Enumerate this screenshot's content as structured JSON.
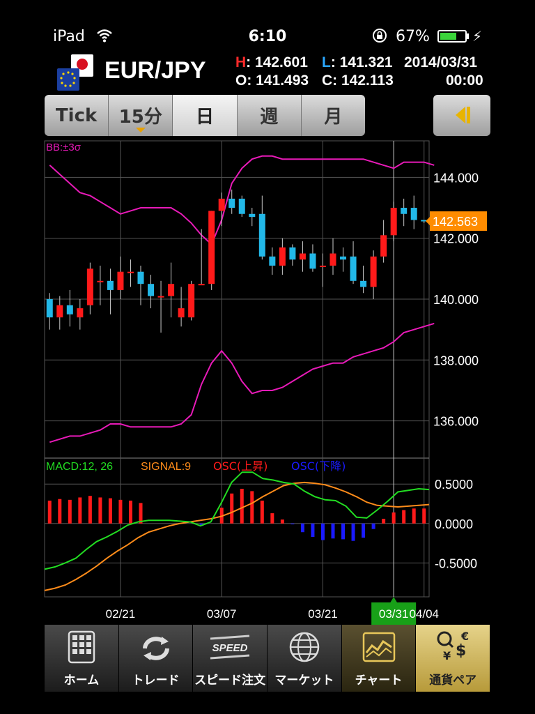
{
  "status": {
    "carrier": "iPad",
    "time": "6:10",
    "battery": "67%",
    "battery_level": 0.67
  },
  "header": {
    "pair": "EUR/JPY",
    "h_key": "H",
    "h": ": 142.601",
    "l_key": "L",
    "l": ": 141.321",
    "o": "O: 141.493",
    "c": "C: 142.113",
    "date": "2014/03/31",
    "time": "00:00"
  },
  "tabs": [
    {
      "label": "Tick"
    },
    {
      "label": "15分"
    },
    {
      "label": "日"
    },
    {
      "label": "週"
    },
    {
      "label": "月"
    }
  ],
  "selected_tab": "日",
  "nav": [
    {
      "label": "ホーム",
      "icon": "home-grid-icon"
    },
    {
      "label": "トレード",
      "icon": "refresh-arrows-icon"
    },
    {
      "label": "スピード注文",
      "icon": "speed-icon",
      "icon_text": "SPEED"
    },
    {
      "label": "マーケット",
      "icon": "globe-icon"
    },
    {
      "label": "チャート",
      "icon": "chart-icon"
    },
    {
      "label": "通貨ペア",
      "icon": "currency-icon",
      "icon_text": [
        "€",
        "$",
        "¥"
      ]
    }
  ],
  "chart_data": {
    "type": "candlestick",
    "indicator_label": "BB:±3σ",
    "price_axis": {
      "ticks": [
        "144.000",
        "142.000",
        "140.000",
        "138.000",
        "136.000"
      ],
      "min": 134.8,
      "max": 145.2
    },
    "current_price": "142.563",
    "current_value": 142.563,
    "x_labels": [
      "02/21",
      "03/07",
      "03/21",
      "03/31",
      "04/04"
    ],
    "selected_x_label": "03/31",
    "candles": [
      {
        "o": 140.0,
        "h": 140.2,
        "l": 139.0,
        "c": 139.4
      },
      {
        "o": 139.4,
        "h": 140.1,
        "l": 139.0,
        "c": 139.8
      },
      {
        "o": 139.8,
        "h": 140.3,
        "l": 139.1,
        "c": 139.5
      },
      {
        "o": 139.4,
        "h": 140.0,
        "l": 139.0,
        "c": 139.7
      },
      {
        "o": 139.8,
        "h": 141.2,
        "l": 139.5,
        "c": 141.0
      },
      {
        "o": 140.6,
        "h": 141.1,
        "l": 139.8,
        "c": 140.6
      },
      {
        "o": 140.6,
        "h": 141.0,
        "l": 139.5,
        "c": 140.3
      },
      {
        "o": 140.3,
        "h": 141.4,
        "l": 140.0,
        "c": 140.9
      },
      {
        "o": 140.9,
        "h": 141.3,
        "l": 140.4,
        "c": 140.9
      },
      {
        "o": 140.9,
        "h": 141.1,
        "l": 139.8,
        "c": 140.5
      },
      {
        "o": 140.5,
        "h": 140.8,
        "l": 139.7,
        "c": 140.1
      },
      {
        "o": 140.1,
        "h": 140.6,
        "l": 138.9,
        "c": 140.1
      },
      {
        "o": 140.1,
        "h": 141.2,
        "l": 139.4,
        "c": 140.5
      },
      {
        "o": 139.4,
        "h": 140.4,
        "l": 139.1,
        "c": 139.7
      },
      {
        "o": 139.4,
        "h": 140.6,
        "l": 139.3,
        "c": 140.5
      },
      {
        "o": 140.5,
        "h": 142.3,
        "l": 140.5,
        "c": 140.5
      },
      {
        "o": 140.5,
        "h": 142.9,
        "l": 140.3,
        "c": 142.9
      },
      {
        "o": 142.9,
        "h": 143.5,
        "l": 142.4,
        "c": 143.3
      },
      {
        "o": 143.3,
        "h": 143.6,
        "l": 142.8,
        "c": 143.0
      },
      {
        "o": 143.3,
        "h": 143.4,
        "l": 142.7,
        "c": 142.8
      },
      {
        "o": 142.8,
        "h": 143.0,
        "l": 142.4,
        "c": 142.7
      },
      {
        "o": 142.8,
        "h": 143.4,
        "l": 141.3,
        "c": 141.4
      },
      {
        "o": 141.4,
        "h": 141.7,
        "l": 140.8,
        "c": 141.1
      },
      {
        "o": 141.1,
        "h": 142.0,
        "l": 140.8,
        "c": 141.7
      },
      {
        "o": 141.7,
        "h": 141.8,
        "l": 141.1,
        "c": 141.3
      },
      {
        "o": 141.3,
        "h": 141.9,
        "l": 140.9,
        "c": 141.5
      },
      {
        "o": 141.5,
        "h": 141.8,
        "l": 140.9,
        "c": 141.0
      },
      {
        "o": 141.1,
        "h": 141.5,
        "l": 140.4,
        "c": 141.1
      },
      {
        "o": 141.1,
        "h": 142.0,
        "l": 140.8,
        "c": 141.5
      },
      {
        "o": 141.4,
        "h": 141.7,
        "l": 140.9,
        "c": 141.3
      },
      {
        "o": 141.4,
        "h": 141.9,
        "l": 140.5,
        "c": 140.6
      },
      {
        "o": 140.6,
        "h": 141.1,
        "l": 140.2,
        "c": 140.4
      },
      {
        "o": 140.4,
        "h": 141.6,
        "l": 140.0,
        "c": 141.4
      },
      {
        "o": 141.4,
        "h": 142.6,
        "l": 141.2,
        "c": 142.1
      },
      {
        "o": 142.1,
        "h": 143.2,
        "l": 141.9,
        "c": 143.0
      },
      {
        "o": 143.0,
        "h": 143.3,
        "l": 142.4,
        "c": 142.8
      },
      {
        "o": 143.0,
        "h": 143.4,
        "l": 142.3,
        "c": 142.6
      },
      {
        "o": 142.6,
        "h": 142.6,
        "l": 142.5,
        "c": 142.563
      }
    ],
    "bb_upper": [
      144.4,
      144.1,
      143.8,
      143.5,
      143.4,
      143.2,
      143.0,
      142.8,
      142.9,
      143.0,
      143.0,
      143.0,
      143.0,
      142.8,
      142.5,
      142.1,
      141.8,
      142.6,
      143.8,
      144.3,
      144.6,
      144.7,
      144.7,
      144.6,
      144.6,
      144.6,
      144.6,
      144.6,
      144.6,
      144.6,
      144.6,
      144.6,
      144.5,
      144.4,
      144.3,
      144.5,
      144.5,
      144.5,
      144.4
    ],
    "bb_lower": [
      135.3,
      135.4,
      135.5,
      135.5,
      135.6,
      135.7,
      135.9,
      135.9,
      135.8,
      135.8,
      135.8,
      135.8,
      135.8,
      135.9,
      136.2,
      137.2,
      137.9,
      138.3,
      137.9,
      137.3,
      136.9,
      137.0,
      137.0,
      137.1,
      137.3,
      137.5,
      137.7,
      137.8,
      137.9,
      137.9,
      138.1,
      138.2,
      138.3,
      138.4,
      138.6,
      138.9,
      139.0,
      139.1,
      139.2
    ],
    "macd": {
      "labels": {
        "macd": "MACD:12, 26",
        "signal": "SIGNAL:9",
        "osc_up": "OSC(上昇)",
        "osc_down": "OSC(下降)"
      },
      "axis_ticks": [
        "0.5000",
        "0.0000",
        "-0.5000"
      ],
      "min": -0.93,
      "max": 0.82,
      "macd_line": [
        -0.58,
        -0.55,
        -0.5,
        -0.44,
        -0.33,
        -0.23,
        -0.17,
        -0.1,
        -0.02,
        0.02,
        0.04,
        0.04,
        0.04,
        0.03,
        0.02,
        -0.03,
        0.02,
        0.26,
        0.52,
        0.65,
        0.65,
        0.57,
        0.55,
        0.52,
        0.5,
        0.41,
        0.34,
        0.3,
        0.29,
        0.22,
        0.08,
        0.07,
        0.17,
        0.28,
        0.4,
        0.42,
        0.44,
        0.43
      ],
      "signal_line": [
        -0.85,
        -0.82,
        -0.78,
        -0.71,
        -0.63,
        -0.54,
        -0.44,
        -0.35,
        -0.27,
        -0.18,
        -0.11,
        -0.07,
        -0.03,
        0.0,
        0.02,
        0.04,
        0.06,
        0.09,
        0.14,
        0.2,
        0.26,
        0.34,
        0.41,
        0.48,
        0.51,
        0.52,
        0.51,
        0.49,
        0.45,
        0.4,
        0.34,
        0.27,
        0.23,
        0.22,
        0.21,
        0.22,
        0.23,
        0.24
      ],
      "osc": [
        0.29,
        0.31,
        0.3,
        0.33,
        0.35,
        0.33,
        0.32,
        0.3,
        0.29,
        0.26,
        0.0,
        0.0,
        0.0,
        0.0,
        0.0,
        -0.03,
        0.0,
        0.2,
        0.38,
        0.44,
        0.41,
        0.29,
        0.13,
        0.05,
        -0.01,
        -0.11,
        -0.17,
        -0.21,
        -0.19,
        -0.2,
        -0.22,
        -0.18,
        -0.07,
        0.06,
        0.14,
        0.17,
        0.19,
        0.19
      ]
    }
  },
  "colors": {
    "up": "#ff1a1a",
    "down": "#22b8e8",
    "bb": "#e81ab8",
    "macd": "#22dd22",
    "signal": "#ff8c1a",
    "osc_up": "#ff1a1a",
    "osc_down": "#1a1aff",
    "price_tag": "#ff8c00"
  }
}
